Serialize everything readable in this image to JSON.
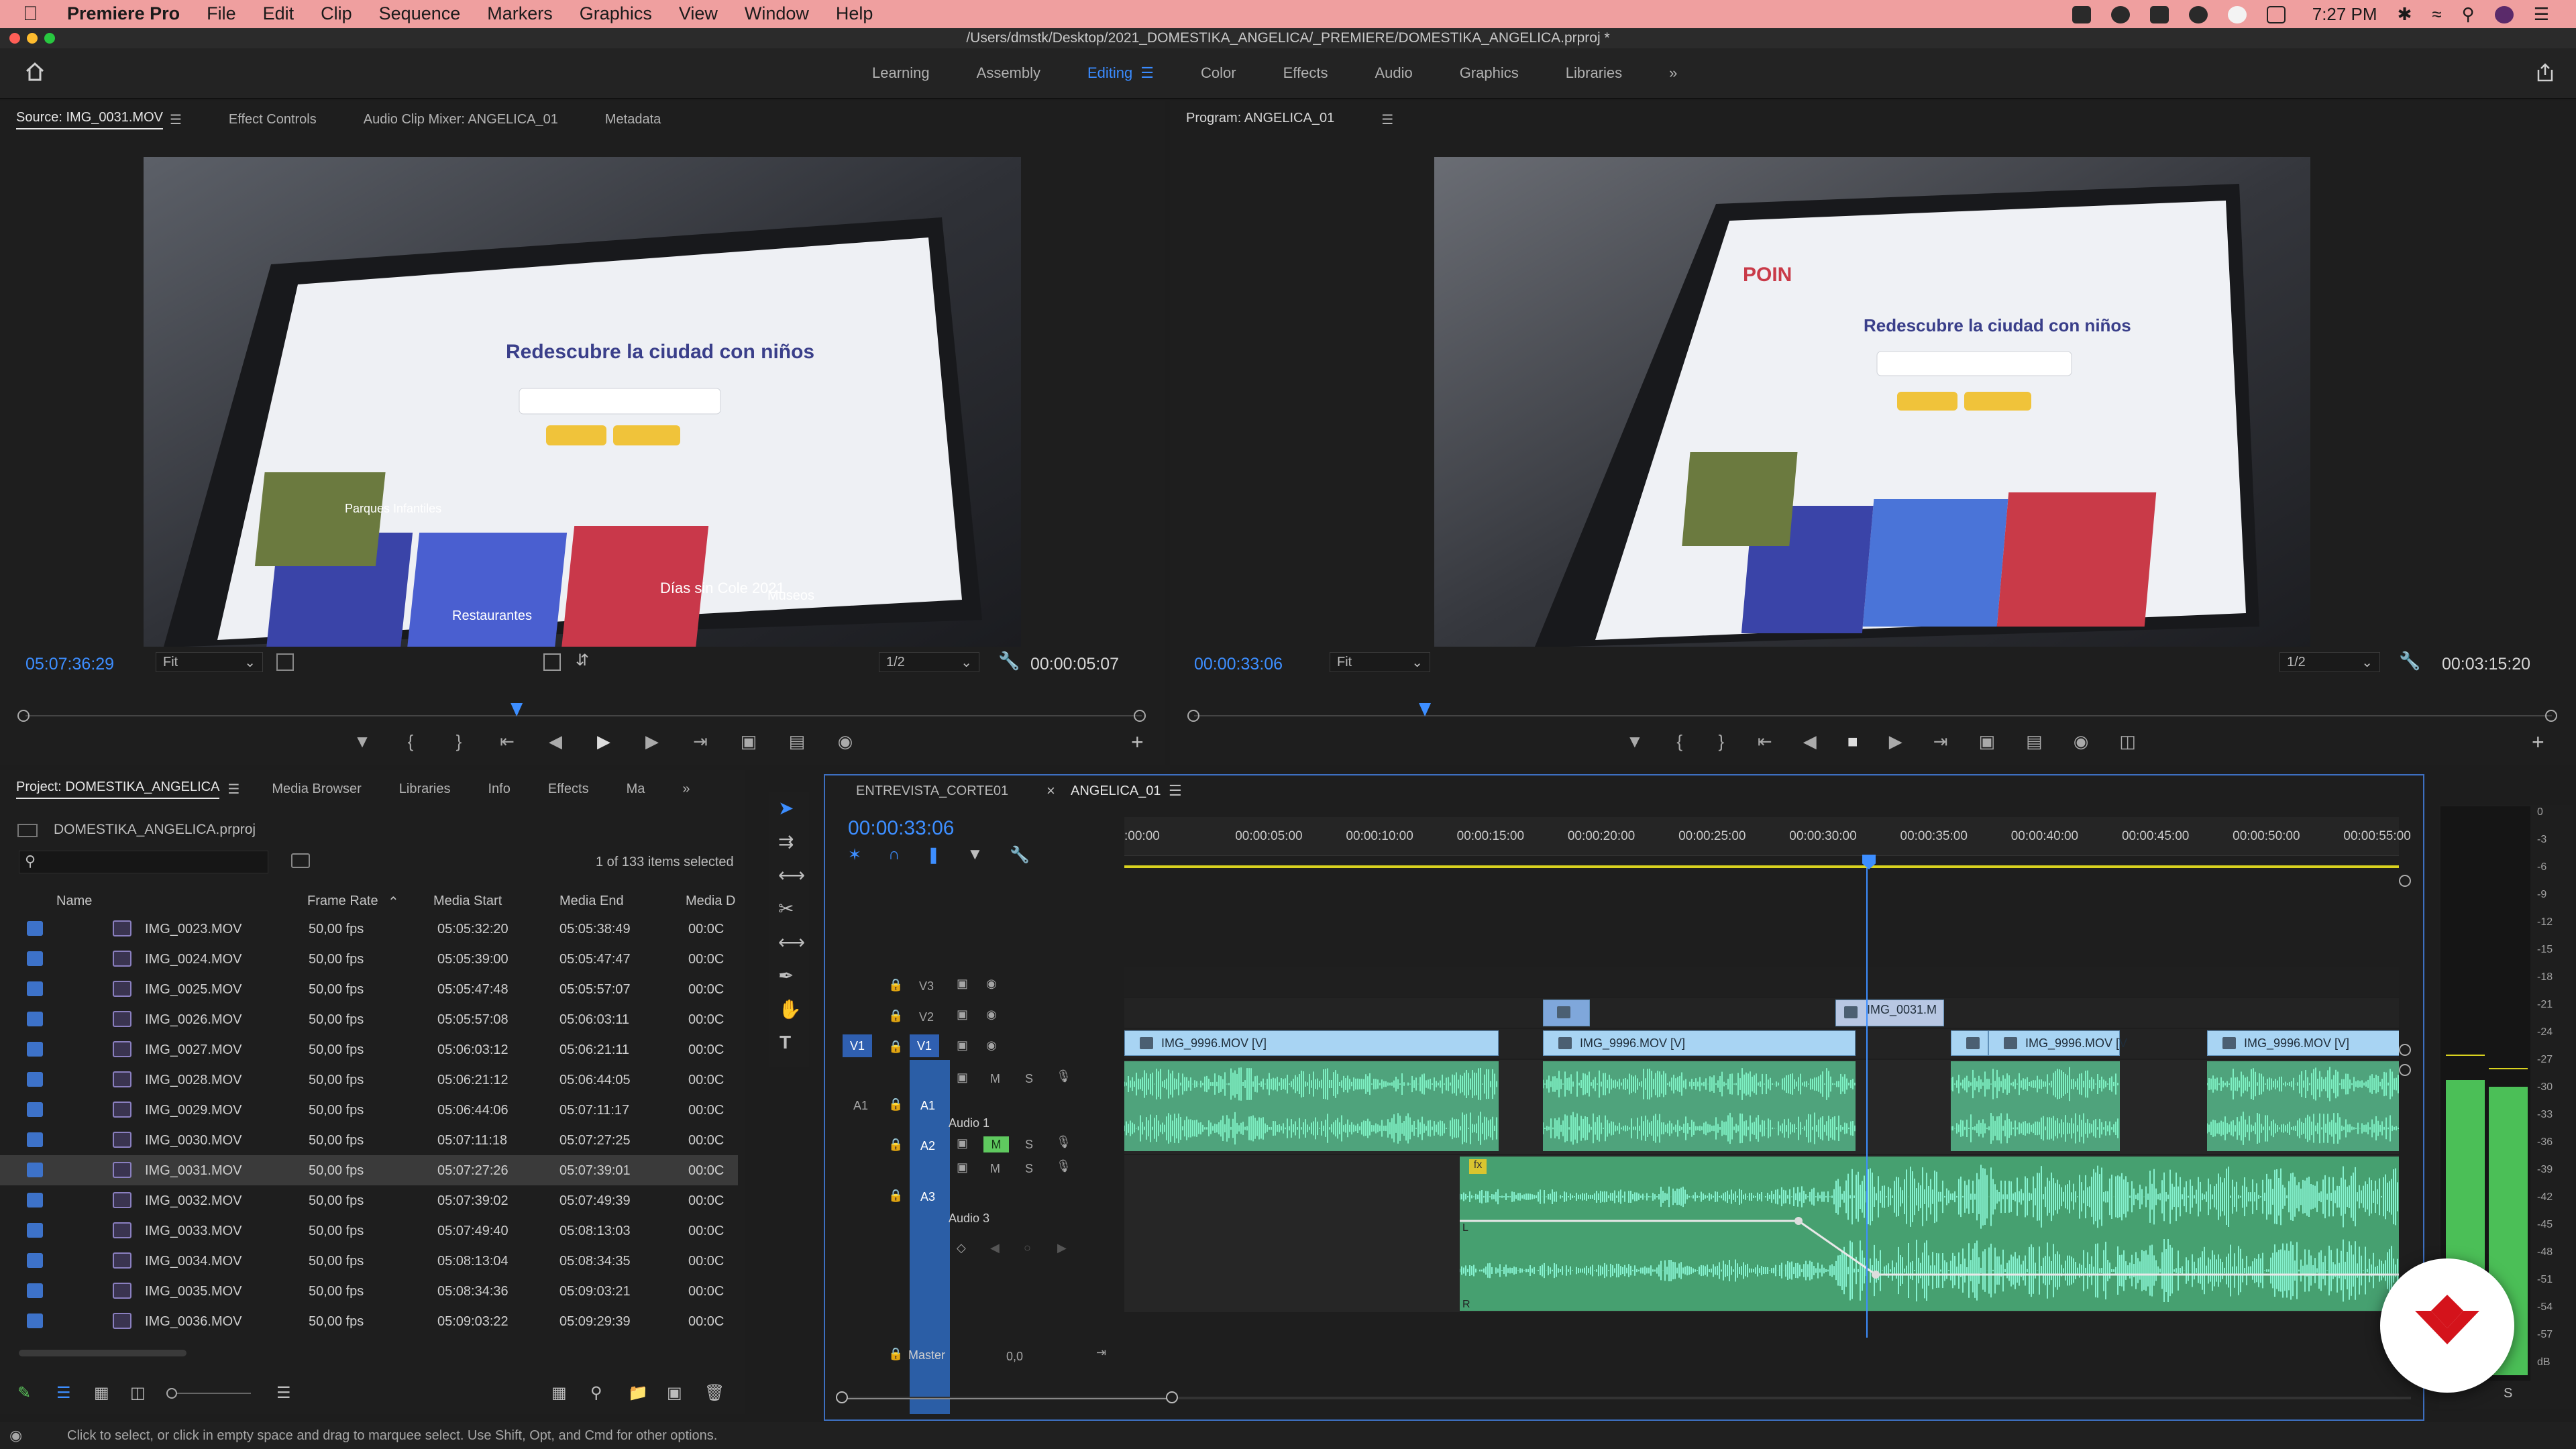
{
  "menubar": {
    "app": "Premiere Pro",
    "menus": [
      "File",
      "Edit",
      "Clip",
      "Sequence",
      "Markers",
      "Graphics",
      "View",
      "Window",
      "Help"
    ],
    "clock": "7:27 PM"
  },
  "window": {
    "title": "/Users/dmstk/Desktop/2021_DOMESTIKA_ANGELICA/_PREMIERE/DOMESTIKA_ANGELICA.prproj *"
  },
  "workspaces": {
    "tabs": [
      "Learning",
      "Assembly",
      "Editing",
      "Color",
      "Effects",
      "Audio",
      "Graphics",
      "Libraries"
    ],
    "active": "Editing",
    "more": "»"
  },
  "source": {
    "tabs": [
      "Source: IMG_0031.MOV",
      "Effect Controls",
      "Audio Clip Mixer: ANGELICA_01",
      "Metadata"
    ],
    "timecode": "05:07:36:29",
    "fit": "Fit",
    "resolution": "1/2",
    "duration": "00:00:05:07",
    "playhead_fraction": 0.44,
    "frame_texts": [
      "Redescubre la ciudad con niños",
      "Días sin Cole 2021",
      "Museos",
      "Restaurantes",
      "Parques Infantiles"
    ]
  },
  "program": {
    "tab": "Program: ANGELICA_01",
    "timecode": "00:00:33:06",
    "fit": "Fit",
    "resolution": "1/2",
    "duration": "00:03:15:20",
    "playhead_fraction": 0.17,
    "frame_texts": [
      "POIN",
      "Redescubre la ciudad con niños"
    ]
  },
  "project": {
    "tabs": [
      "Project: DOMESTIKA_ANGELICA",
      "Media Browser",
      "Libraries",
      "Info",
      "Effects",
      "Ma"
    ],
    "file": "DOMESTIKA_ANGELICA.prproj",
    "search_placeholder": "",
    "selection_info": "1 of 133 items selected",
    "columns": [
      "Name",
      "Frame Rate",
      "Media Start",
      "Media End",
      "Media D"
    ],
    "rows": [
      {
        "name": "IMG_0023.MOV",
        "fps": "50,00 fps",
        "start": "05:05:32:20",
        "end": "05:05:38:49",
        "dur": "00:0C",
        "selected": false
      },
      {
        "name": "IMG_0024.MOV",
        "fps": "50,00 fps",
        "start": "05:05:39:00",
        "end": "05:05:47:47",
        "dur": "00:0C",
        "selected": false
      },
      {
        "name": "IMG_0025.MOV",
        "fps": "50,00 fps",
        "start": "05:05:47:48",
        "end": "05:05:57:07",
        "dur": "00:0C",
        "selected": false
      },
      {
        "name": "IMG_0026.MOV",
        "fps": "50,00 fps",
        "start": "05:05:57:08",
        "end": "05:06:03:11",
        "dur": "00:0C",
        "selected": false
      },
      {
        "name": "IMG_0027.MOV",
        "fps": "50,00 fps",
        "start": "05:06:03:12",
        "end": "05:06:21:11",
        "dur": "00:0C",
        "selected": false
      },
      {
        "name": "IMG_0028.MOV",
        "fps": "50,00 fps",
        "start": "05:06:21:12",
        "end": "05:06:44:05",
        "dur": "00:0C",
        "selected": false
      },
      {
        "name": "IMG_0029.MOV",
        "fps": "50,00 fps",
        "start": "05:06:44:06",
        "end": "05:07:11:17",
        "dur": "00:0C",
        "selected": false
      },
      {
        "name": "IMG_0030.MOV",
        "fps": "50,00 fps",
        "start": "05:07:11:18",
        "end": "05:07:27:25",
        "dur": "00:0C",
        "selected": false
      },
      {
        "name": "IMG_0031.MOV",
        "fps": "50,00 fps",
        "start": "05:07:27:26",
        "end": "05:07:39:01",
        "dur": "00:0C",
        "selected": true
      },
      {
        "name": "IMG_0032.MOV",
        "fps": "50,00 fps",
        "start": "05:07:39:02",
        "end": "05:07:49:39",
        "dur": "00:0C",
        "selected": false
      },
      {
        "name": "IMG_0033.MOV",
        "fps": "50,00 fps",
        "start": "05:07:49:40",
        "end": "05:08:13:03",
        "dur": "00:0C",
        "selected": false
      },
      {
        "name": "IMG_0034.MOV",
        "fps": "50,00 fps",
        "start": "05:08:13:04",
        "end": "05:08:34:35",
        "dur": "00:0C",
        "selected": false
      },
      {
        "name": "IMG_0035.MOV",
        "fps": "50,00 fps",
        "start": "05:08:34:36",
        "end": "05:09:03:21",
        "dur": "00:0C",
        "selected": false
      },
      {
        "name": "IMG_0036.MOV",
        "fps": "50,00 fps",
        "start": "05:09:03:22",
        "end": "05:09:29:39",
        "dur": "00:0C",
        "selected": false
      }
    ]
  },
  "timeline": {
    "tabs": [
      "ENTREVISTA_CORTE01",
      "ANGELICA_01"
    ],
    "close": "×",
    "timecode": "00:00:33:06",
    "ruler": [
      ":00:00",
      "00:00:05:00",
      "00:00:10:00",
      "00:00:15:00",
      "00:00:20:00",
      "00:00:25:00",
      "00:00:30:00",
      "00:00:35:00",
      "00:00:40:00",
      "00:00:45:00",
      "00:00:50:00",
      "00:00:55:00"
    ],
    "tracks": {
      "v3": "V3",
      "v2": "V2",
      "v1": "V1",
      "v1src": "V1",
      "a1": "A1",
      "a1src": "A1",
      "a1name": "Audio 1",
      "a2": "A2",
      "a3": "A3",
      "a3name": "Audio 3",
      "m": "M",
      "s": "S",
      "master": "Master",
      "master_val": "0,0"
    },
    "v1_clips": [
      {
        "label": "IMG_9996.MOV [V]"
      },
      {
        "label": "IMG_9996.MOV [V]"
      },
      {
        "label": "IMG_9996.MOV [V"
      },
      {
        "label": "IMG_9996.MOV [V]"
      }
    ],
    "v2_clip": "IMG_0031.M",
    "fx_badge": "fx",
    "a3_channel_l": "L",
    "a3_channel_r": "R"
  },
  "meters": {
    "scale": [
      "0",
      "-3",
      "-6",
      "-9",
      "-12",
      "-15",
      "-18",
      "-21",
      "-24",
      "-27",
      "-30",
      "-33",
      "-36",
      "-39",
      "-42",
      "-45",
      "-48",
      "-51",
      "-54",
      "-57",
      "dB"
    ],
    "solo": "S"
  },
  "status": {
    "text": "Click to select, or click in empty space and drag to marquee select. Use Shift, Opt, and Cmd for other options."
  },
  "colors": {
    "accent": "#3d8eff",
    "audio": "#4fa37c",
    "video_clip": "#a8d4f3",
    "brand": "#d4131b"
  }
}
